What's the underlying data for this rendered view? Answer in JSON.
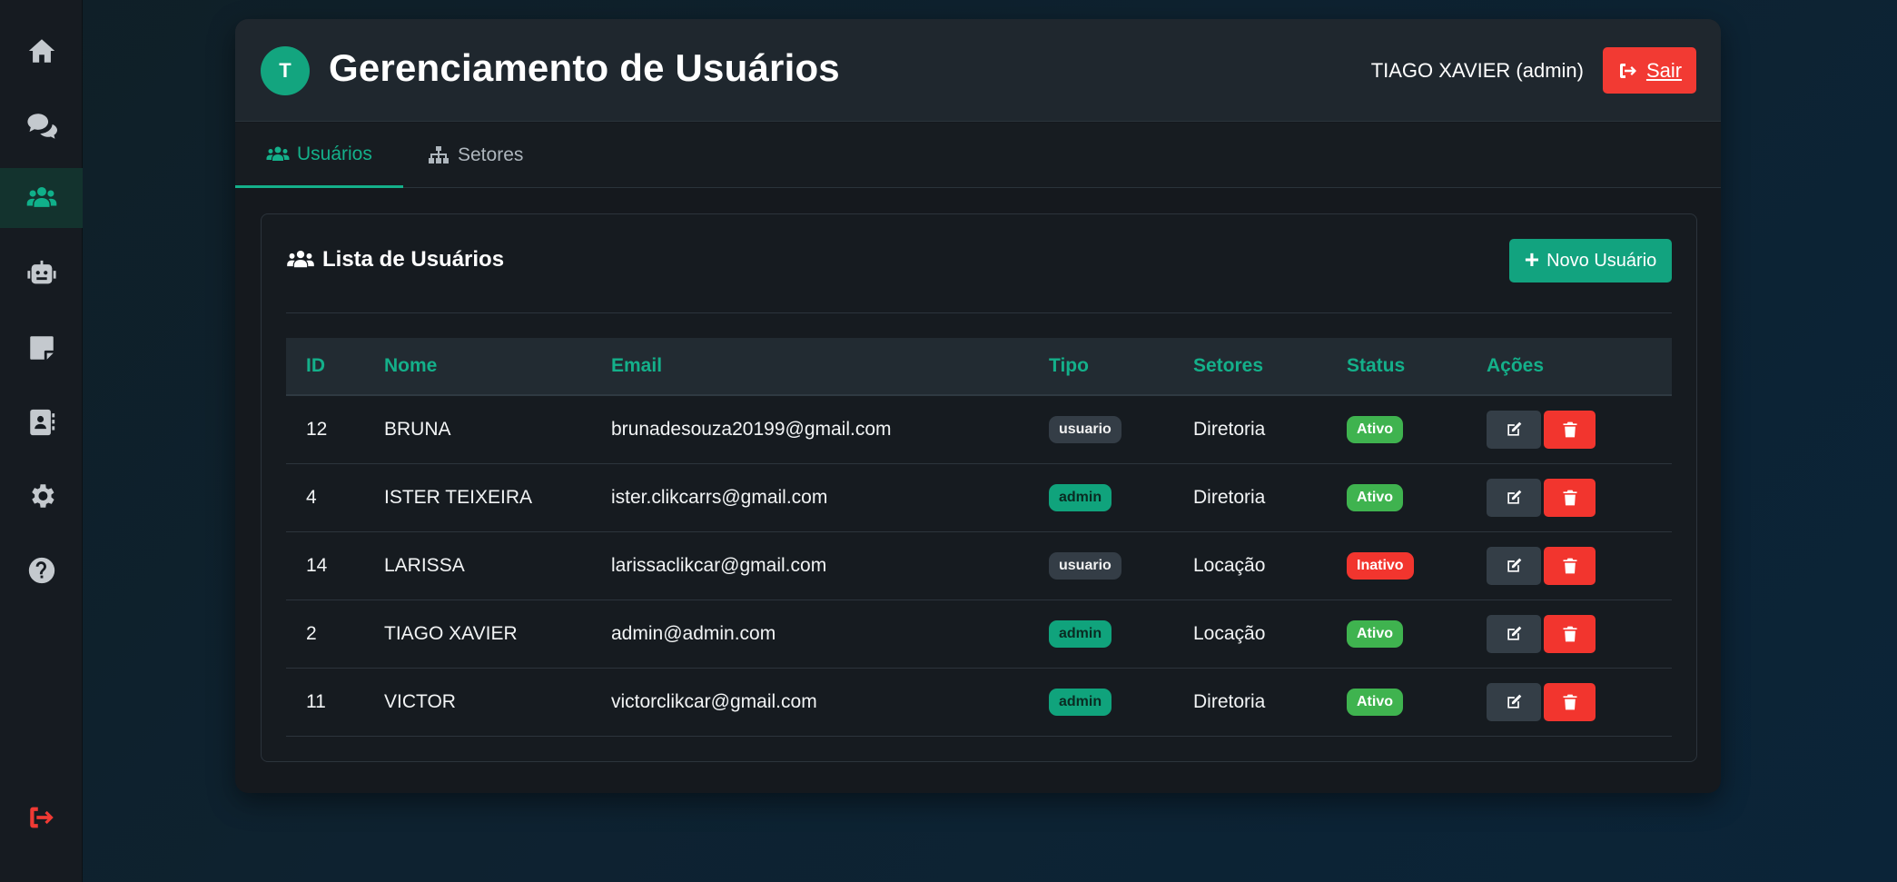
{
  "sidebar": {
    "items": [
      {
        "icon": "home-icon"
      },
      {
        "icon": "chat-icon"
      },
      {
        "icon": "users-icon"
      },
      {
        "icon": "robot-icon"
      },
      {
        "icon": "note-icon"
      },
      {
        "icon": "contacts-icon"
      },
      {
        "icon": "gear-icon"
      },
      {
        "icon": "help-icon"
      }
    ],
    "logout_icon": "logout-icon"
  },
  "header": {
    "avatar_letter": "T",
    "title": "Gerenciamento de Usuários",
    "user_label": "TIAGO XAVIER (admin)",
    "logout_label": "Sair"
  },
  "tabs": [
    {
      "label": "Usuários",
      "icon": "users-icon",
      "active": true
    },
    {
      "label": "Setores",
      "icon": "sitemap-icon",
      "active": false
    }
  ],
  "panel": {
    "title": "Lista de Usuários",
    "new_button_label": "Novo Usuário"
  },
  "table": {
    "columns": [
      "ID",
      "Nome",
      "Email",
      "Tipo",
      "Setores",
      "Status",
      "Ações"
    ],
    "rows": [
      {
        "id": "12",
        "nome": "BRUNA",
        "email": "brunadesouza20199@gmail.com",
        "tipo": "usuario",
        "setores": "Diretoria",
        "status": "Ativo"
      },
      {
        "id": "4",
        "nome": "ISTER TEIXEIRA",
        "email": "ister.clikcarrs@gmail.com",
        "tipo": "admin",
        "setores": "Diretoria",
        "status": "Ativo"
      },
      {
        "id": "14",
        "nome": "LARISSA",
        "email": "larissaclikcar@gmail.com",
        "tipo": "usuario",
        "setores": "Locação",
        "status": "Inativo"
      },
      {
        "id": "2",
        "nome": "TIAGO XAVIER",
        "email": "admin@admin.com",
        "tipo": "admin",
        "setores": "Locação",
        "status": "Ativo"
      },
      {
        "id": "11",
        "nome": "VICTOR",
        "email": "victorclikcar@gmail.com",
        "tipo": "admin",
        "setores": "Diretoria",
        "status": "Ativo"
      }
    ]
  },
  "colors": {
    "accent": "#14b08a",
    "danger": "#f2352e",
    "success": "#3fb34f"
  }
}
